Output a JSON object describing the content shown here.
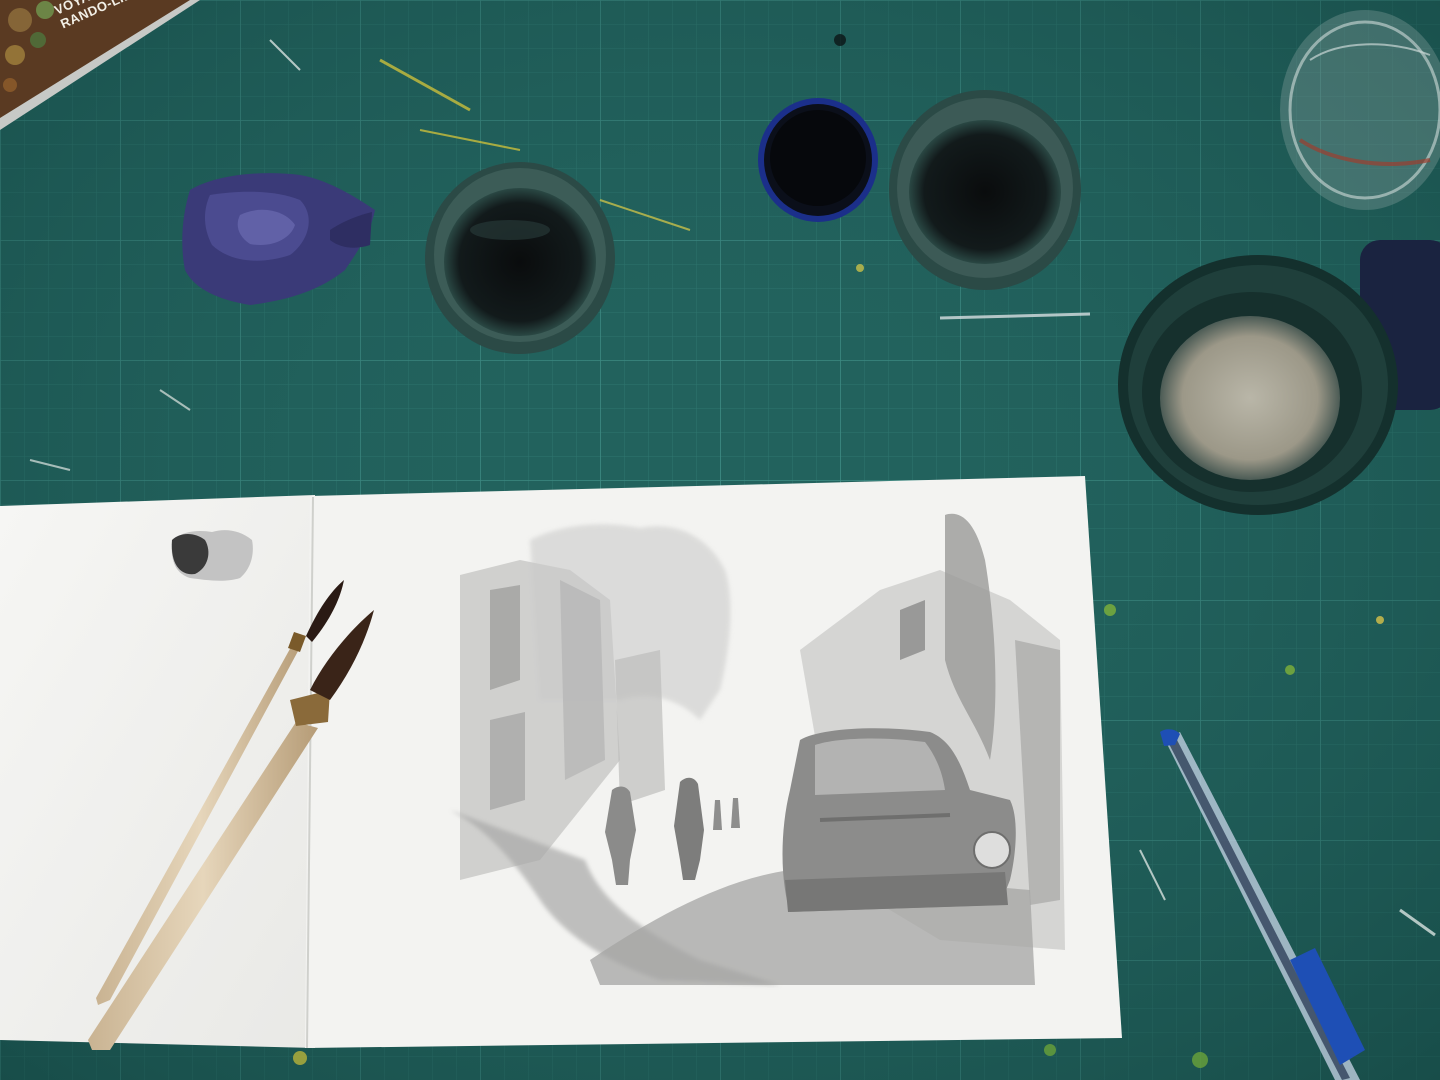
{
  "scene": {
    "description_visible_text": true,
    "book": {
      "line1": "VOYAGE",
      "line2": "RANDO-LIBE"
    },
    "colors": {
      "mat": "#1f5e5a",
      "grid_line": "#3c8a82",
      "paper": "#f4f4f2",
      "ink": "#0c1416",
      "wash": "#9a9a9a",
      "pen_blue": "#1e4fb5"
    }
  }
}
